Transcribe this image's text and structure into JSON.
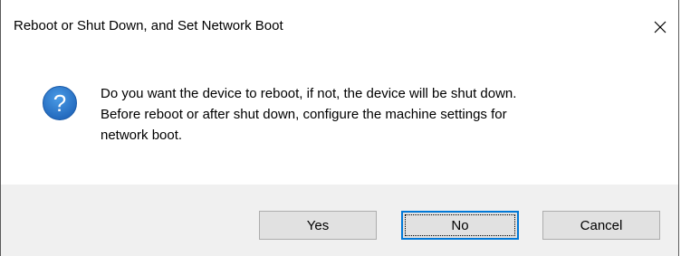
{
  "window": {
    "title": "Reboot or Shut Down, and Set Network Boot",
    "close_icon": "close-icon"
  },
  "message": {
    "icon": "question-icon",
    "icon_color": "#1e73c8",
    "lines": [
      "Do you want the device to reboot, if not, the device will be shut down.",
      "Before reboot or after shut down, configure the machine settings for",
      "network boot."
    ]
  },
  "buttons": {
    "yes_label": "Yes",
    "no_label": "No",
    "cancel_label": "Cancel",
    "default": "No",
    "default_border_color": "#0078d7"
  }
}
